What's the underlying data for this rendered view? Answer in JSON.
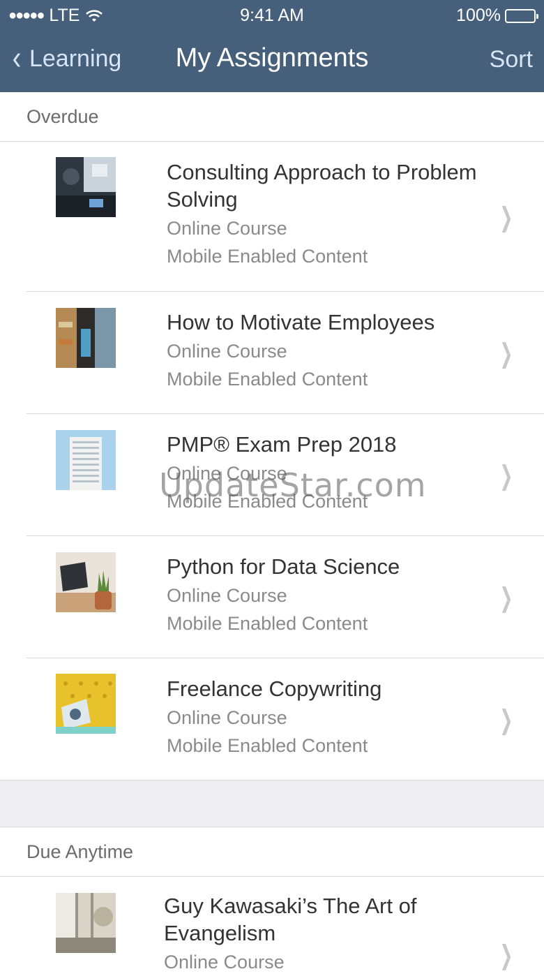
{
  "status_bar": {
    "signal": "●●●●●",
    "carrier": "LTE",
    "time": "9:41 AM",
    "battery": "100%"
  },
  "nav": {
    "back_label": "Learning",
    "title": "My Assignments",
    "sort_label": "Sort"
  },
  "sections": [
    {
      "title": "Overdue",
      "items": [
        {
          "name": "Consulting Approach to Problem Solving",
          "type": "Online Course",
          "tag": "Mobile Enabled Content"
        },
        {
          "name": "How to Motivate Employees",
          "type": "Online Course",
          "tag": "Mobile Enabled Content"
        },
        {
          "name": "PMP® Exam Prep 2018",
          "type": "Online Course",
          "tag": "Mobile Enabled Content"
        },
        {
          "name": "Python for Data Science",
          "type": "Online Course",
          "tag": "Mobile Enabled Content"
        },
        {
          "name": "Freelance Copywriting",
          "type": "Online Course",
          "tag": "Mobile Enabled Content"
        }
      ]
    },
    {
      "title": "Due Anytime",
      "items": [
        {
          "name": "Guy Kawasaki’s The Art of Evangelism",
          "type": "Online Course"
        }
      ]
    }
  ],
  "watermark": "UpdateStar.com",
  "colors": {
    "header": "#465f7a",
    "link": "#d6e4f5"
  }
}
